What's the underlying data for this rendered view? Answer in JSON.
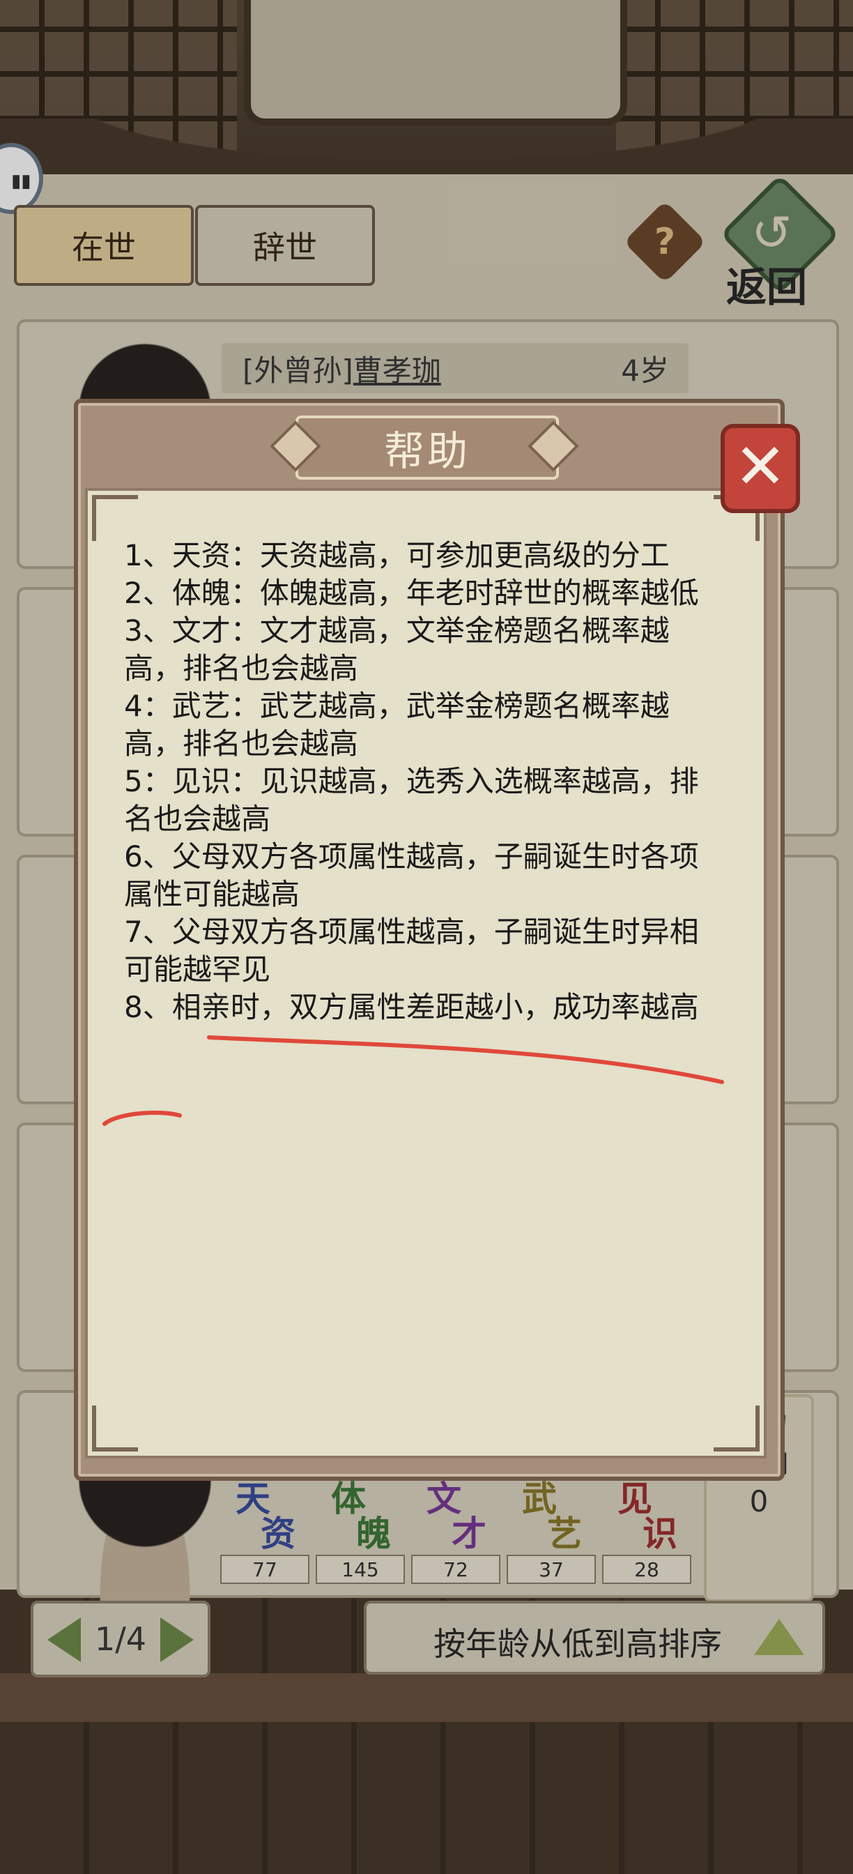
{
  "header": {
    "tabs": [
      {
        "label": "在世",
        "active": true
      },
      {
        "label": "辞世",
        "active": false
      }
    ],
    "help_icon": "question-icon",
    "back_label": "返回"
  },
  "card": {
    "kin": "[外曾孙]",
    "name": "曹孝珈",
    "age": "4岁",
    "influence_label_partial": "势力"
  },
  "attributes": [
    {
      "g1": "天",
      "g2": "资",
      "color": "#3a4fa0",
      "value": "77"
    },
    {
      "g1": "体",
      "g2": "魄",
      "color": "#3f7a3a",
      "value": "145"
    },
    {
      "g1": "文",
      "g2": "才",
      "color": "#7a3a9a",
      "value": "72"
    },
    {
      "g1": "武",
      "g2": "艺",
      "color": "#8a7a2a",
      "value": "37"
    },
    {
      "g1": "见",
      "g2": "识",
      "color": "#a03030",
      "value": "28"
    }
  ],
  "influence": {
    "label_line1": "势力",
    "label_line2": "影响",
    "value": "0"
  },
  "pager": {
    "page": "1/4"
  },
  "sort": {
    "label": "按年龄从低到高排序"
  },
  "dialog": {
    "title": "帮助",
    "lines": [
      "1、天资：天资越高，可参加更高级的分工",
      "2、体魄：体魄越高，年老时辞世的概率越低",
      "3、文才：文才越高，文举金榜题名概率越高，排名也会越高",
      "4：武艺：武艺越高，武举金榜题名概率越高，排名也会越高",
      "5：见识：见识越高，选秀入选概率越高，排名也会越高",
      "6、父母双方各项属性越高，子嗣诞生时各项属性可能越高",
      "7、父母双方各项属性越高，子嗣诞生时异相可能越罕见",
      "8、相亲时，双方属性差距越小，成功率越高"
    ]
  },
  "colors": {
    "annotation": "#e0483a",
    "page_background": "#d7cfb9",
    "paper": "#e4e0c9"
  }
}
